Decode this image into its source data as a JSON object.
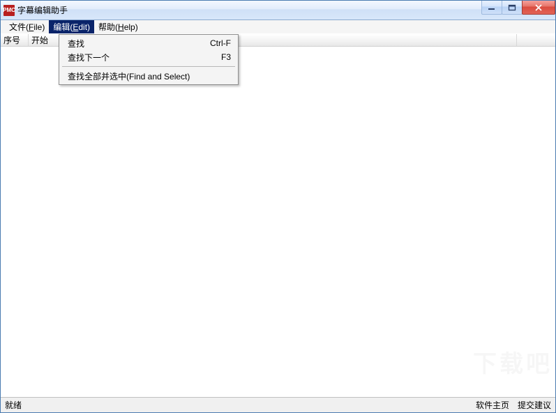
{
  "app_icon_text": "PMC",
  "title": "字幕编辑助手",
  "menubar": {
    "file": {
      "label": "文件(",
      "mnemonic": "F",
      "tail": "ile)"
    },
    "edit": {
      "label": "编辑(",
      "mnemonic": "E",
      "tail": "dit)"
    },
    "help": {
      "label": "帮助(",
      "mnemonic": "H",
      "tail": "elp)"
    }
  },
  "dropdown": {
    "find": {
      "label": "查找",
      "shortcut": "Ctrl-F"
    },
    "find_next": {
      "label": "查找下一个",
      "shortcut": "F3"
    },
    "find_select": {
      "label": "查找全部并选中(Find and Select)"
    }
  },
  "table": {
    "col_number": "序号",
    "col_start": "开始"
  },
  "statusbar": {
    "ready": "就绪",
    "homepage": "软件主页",
    "feedback": "提交建议"
  },
  "watermark": "下载吧"
}
